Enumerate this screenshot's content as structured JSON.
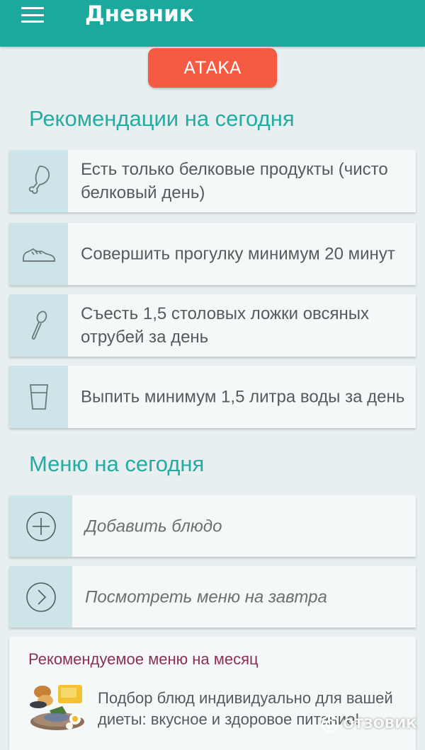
{
  "appbar": {
    "title": "Дневник",
    "menu_icon": "hamburger-menu-icon",
    "color": "#1ba99e"
  },
  "phase": {
    "label": "АТАКА",
    "color": "#f55a42"
  },
  "recommendations": {
    "title": "Рекомендации на сегодня",
    "items": [
      {
        "icon": "drumstick-icon",
        "text": "Есть только белковые продукты (чисто белковый день)"
      },
      {
        "icon": "sneaker-icon",
        "text": "Совершить прогулку минимум 20 минут"
      },
      {
        "icon": "spoon-icon",
        "text": "Съесть 1,5 столовых ложки овсяных отрубей за день"
      },
      {
        "icon": "water-glass-icon",
        "text": "Выпить минимум 1,5 литра воды за день"
      }
    ]
  },
  "menu": {
    "title": "Меню на сегодня",
    "add_dish": {
      "icon": "plus-circle-icon",
      "label": "Добавить блюдо"
    },
    "tomorrow": {
      "icon": "chevron-right-circle-icon",
      "label": "Посмотреть меню на завтра"
    }
  },
  "monthly": {
    "title": "Рекомендуемое меню на месяц",
    "image": "food-platter-icon",
    "text": "Подбор блюд индивидуально для вашей диеты: вкусное и здоровое питание!"
  },
  "watermark": {
    "text": "ОТЗОВИК"
  }
}
